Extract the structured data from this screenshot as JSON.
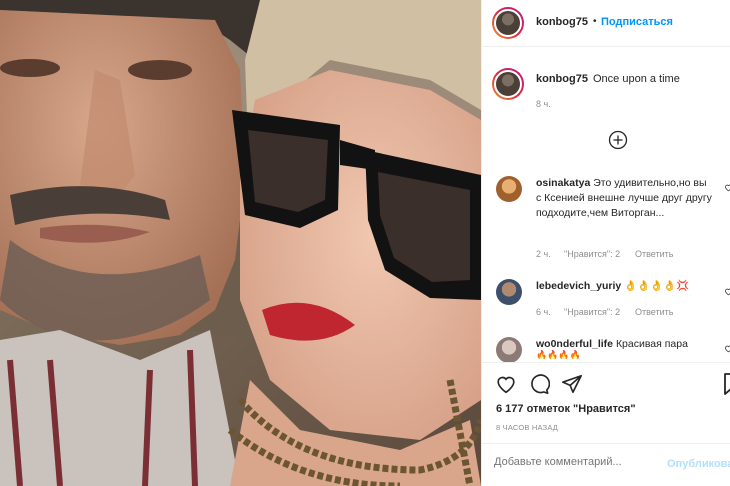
{
  "post": {
    "username": "konbog75",
    "follow_sep": "•",
    "follow_label": "Подписаться",
    "caption_user": "konbog75",
    "caption_text": "Once upon a time",
    "caption_time": "8 ч."
  },
  "comments": [
    {
      "user": "osinakatya",
      "text": "Это удивительно,но вы с Ксенией внешне лучше друг другу подходите,чем Виторган...",
      "time": "2 ч.",
      "likes": "\"Нравится\": 2",
      "reply": "Ответить"
    },
    {
      "user": "lebedevich_yuriy",
      "text": "👌👌👌👌💢",
      "time": "6 ч.",
      "likes": "\"Нравится\": 2",
      "reply": "Ответить"
    },
    {
      "user": "wo0nderful_life",
      "text": "Красивая пара",
      "emoji": "🔥🔥🔥🔥"
    }
  ],
  "footer": {
    "likes_count": "6 177 отметок \"Нравится\"",
    "timestamp": "8 ЧАСОВ НАЗАД",
    "add_comment_placeholder": "Добавьте комментарий...",
    "publish_label": "Опубликовать"
  },
  "colors": {
    "accent": "#0095f6",
    "muted": "#8e8e8e",
    "publish_disabled": "#b2dffc"
  }
}
